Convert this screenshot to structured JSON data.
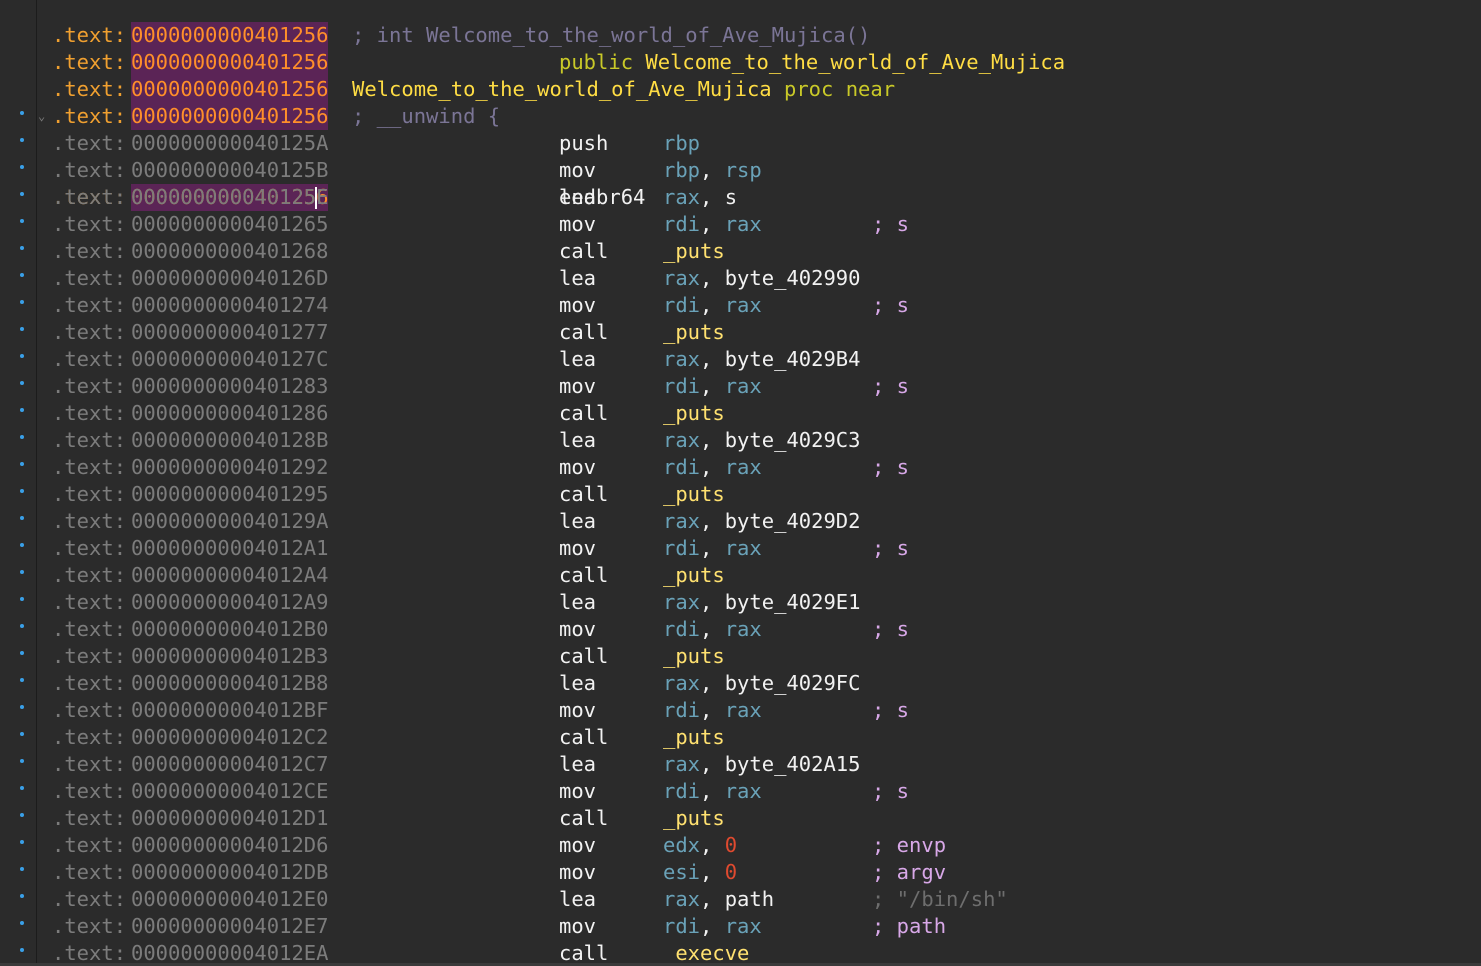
{
  "colors": {
    "background": "#2b2b2b",
    "highlight_address_bg": "#5b2456",
    "highlight_address_fg": "#ff8f2a",
    "register": "#6aa2b8",
    "symbol": "#ffe170",
    "number": "#e04a2f",
    "comment": "#d8a8e8",
    "breakpoint_dot": "#3aa0e8"
  },
  "header_lines": [
    {
      "prefix": ".text:",
      "address": "0000000000401256",
      "comment": "; int Welcome_to_the_world_of_Ave_Mujica()"
    },
    {
      "prefix": ".text:",
      "address": "0000000000401256",
      "keyword": "public",
      "name": "Welcome_to_the_world_of_Ave_Mujica"
    },
    {
      "prefix": ".text:",
      "address": "0000000000401256",
      "name": "Welcome_to_the_world_of_Ave_Mujica",
      "suffix": " proc near"
    },
    {
      "prefix": ".text:",
      "address": "0000000000401256",
      "comment": "; __unwind {"
    }
  ],
  "cursor_line": {
    "prefix": ".text:",
    "address_before_caret": "000000000040125",
    "address_after_caret": "6",
    "mnemonic": "endbr64",
    "fold_icon": "chevron-down-icon"
  },
  "instructions": [
    {
      "prefix": ".text:",
      "address": "000000000040125A",
      "mnemonic": "push",
      "ops": [
        {
          "t": "reg",
          "v": "rbp"
        }
      ],
      "comment": ""
    },
    {
      "prefix": ".text:",
      "address": "000000000040125B",
      "mnemonic": "mov",
      "ops": [
        {
          "t": "reg",
          "v": "rbp"
        },
        {
          "t": "sep",
          "v": ", "
        },
        {
          "t": "reg",
          "v": "rsp"
        }
      ],
      "comment": ""
    },
    {
      "prefix": ".text:",
      "address": "000000000040125E",
      "mnemonic": "lea",
      "ops": [
        {
          "t": "reg",
          "v": "rax"
        },
        {
          "t": "sep",
          "v": ", "
        },
        {
          "t": "plain",
          "v": "s"
        }
      ],
      "comment": ""
    },
    {
      "prefix": ".text:",
      "address": "0000000000401265",
      "mnemonic": "mov",
      "ops": [
        {
          "t": "reg",
          "v": "rdi"
        },
        {
          "t": "sep",
          "v": ", "
        },
        {
          "t": "reg",
          "v": "rax"
        }
      ],
      "comment": "; s"
    },
    {
      "prefix": ".text:",
      "address": "0000000000401268",
      "mnemonic": "call",
      "ops": [
        {
          "t": "sym",
          "v": "_puts"
        }
      ],
      "comment": ""
    },
    {
      "prefix": ".text:",
      "address": "000000000040126D",
      "mnemonic": "lea",
      "ops": [
        {
          "t": "reg",
          "v": "rax"
        },
        {
          "t": "sep",
          "v": ", "
        },
        {
          "t": "plain",
          "v": "byte_402990"
        }
      ],
      "comment": ""
    },
    {
      "prefix": ".text:",
      "address": "0000000000401274",
      "mnemonic": "mov",
      "ops": [
        {
          "t": "reg",
          "v": "rdi"
        },
        {
          "t": "sep",
          "v": ", "
        },
        {
          "t": "reg",
          "v": "rax"
        }
      ],
      "comment": "; s"
    },
    {
      "prefix": ".text:",
      "address": "0000000000401277",
      "mnemonic": "call",
      "ops": [
        {
          "t": "sym",
          "v": "_puts"
        }
      ],
      "comment": ""
    },
    {
      "prefix": ".text:",
      "address": "000000000040127C",
      "mnemonic": "lea",
      "ops": [
        {
          "t": "reg",
          "v": "rax"
        },
        {
          "t": "sep",
          "v": ", "
        },
        {
          "t": "plain",
          "v": "byte_4029B4"
        }
      ],
      "comment": ""
    },
    {
      "prefix": ".text:",
      "address": "0000000000401283",
      "mnemonic": "mov",
      "ops": [
        {
          "t": "reg",
          "v": "rdi"
        },
        {
          "t": "sep",
          "v": ", "
        },
        {
          "t": "reg",
          "v": "rax"
        }
      ],
      "comment": "; s"
    },
    {
      "prefix": ".text:",
      "address": "0000000000401286",
      "mnemonic": "call",
      "ops": [
        {
          "t": "sym",
          "v": "_puts"
        }
      ],
      "comment": ""
    },
    {
      "prefix": ".text:",
      "address": "000000000040128B",
      "mnemonic": "lea",
      "ops": [
        {
          "t": "reg",
          "v": "rax"
        },
        {
          "t": "sep",
          "v": ", "
        },
        {
          "t": "plain",
          "v": "byte_4029C3"
        }
      ],
      "comment": ""
    },
    {
      "prefix": ".text:",
      "address": "0000000000401292",
      "mnemonic": "mov",
      "ops": [
        {
          "t": "reg",
          "v": "rdi"
        },
        {
          "t": "sep",
          "v": ", "
        },
        {
          "t": "reg",
          "v": "rax"
        }
      ],
      "comment": "; s"
    },
    {
      "prefix": ".text:",
      "address": "0000000000401295",
      "mnemonic": "call",
      "ops": [
        {
          "t": "sym",
          "v": "_puts"
        }
      ],
      "comment": ""
    },
    {
      "prefix": ".text:",
      "address": "000000000040129A",
      "mnemonic": "lea",
      "ops": [
        {
          "t": "reg",
          "v": "rax"
        },
        {
          "t": "sep",
          "v": ", "
        },
        {
          "t": "plain",
          "v": "byte_4029D2"
        }
      ],
      "comment": ""
    },
    {
      "prefix": ".text:",
      "address": "00000000004012A1",
      "mnemonic": "mov",
      "ops": [
        {
          "t": "reg",
          "v": "rdi"
        },
        {
          "t": "sep",
          "v": ", "
        },
        {
          "t": "reg",
          "v": "rax"
        }
      ],
      "comment": "; s"
    },
    {
      "prefix": ".text:",
      "address": "00000000004012A4",
      "mnemonic": "call",
      "ops": [
        {
          "t": "sym",
          "v": "_puts"
        }
      ],
      "comment": ""
    },
    {
      "prefix": ".text:",
      "address": "00000000004012A9",
      "mnemonic": "lea",
      "ops": [
        {
          "t": "reg",
          "v": "rax"
        },
        {
          "t": "sep",
          "v": ", "
        },
        {
          "t": "plain",
          "v": "byte_4029E1"
        }
      ],
      "comment": ""
    },
    {
      "prefix": ".text:",
      "address": "00000000004012B0",
      "mnemonic": "mov",
      "ops": [
        {
          "t": "reg",
          "v": "rdi"
        },
        {
          "t": "sep",
          "v": ", "
        },
        {
          "t": "reg",
          "v": "rax"
        }
      ],
      "comment": "; s"
    },
    {
      "prefix": ".text:",
      "address": "00000000004012B3",
      "mnemonic": "call",
      "ops": [
        {
          "t": "sym",
          "v": "_puts"
        }
      ],
      "comment": ""
    },
    {
      "prefix": ".text:",
      "address": "00000000004012B8",
      "mnemonic": "lea",
      "ops": [
        {
          "t": "reg",
          "v": "rax"
        },
        {
          "t": "sep",
          "v": ", "
        },
        {
          "t": "plain",
          "v": "byte_4029FC"
        }
      ],
      "comment": ""
    },
    {
      "prefix": ".text:",
      "address": "00000000004012BF",
      "mnemonic": "mov",
      "ops": [
        {
          "t": "reg",
          "v": "rdi"
        },
        {
          "t": "sep",
          "v": ", "
        },
        {
          "t": "reg",
          "v": "rax"
        }
      ],
      "comment": "; s"
    },
    {
      "prefix": ".text:",
      "address": "00000000004012C2",
      "mnemonic": "call",
      "ops": [
        {
          "t": "sym",
          "v": "_puts"
        }
      ],
      "comment": ""
    },
    {
      "prefix": ".text:",
      "address": "00000000004012C7",
      "mnemonic": "lea",
      "ops": [
        {
          "t": "reg",
          "v": "rax"
        },
        {
          "t": "sep",
          "v": ", "
        },
        {
          "t": "plain",
          "v": "byte_402A15"
        }
      ],
      "comment": ""
    },
    {
      "prefix": ".text:",
      "address": "00000000004012CE",
      "mnemonic": "mov",
      "ops": [
        {
          "t": "reg",
          "v": "rdi"
        },
        {
          "t": "sep",
          "v": ", "
        },
        {
          "t": "reg",
          "v": "rax"
        }
      ],
      "comment": "; s"
    },
    {
      "prefix": ".text:",
      "address": "00000000004012D1",
      "mnemonic": "call",
      "ops": [
        {
          "t": "sym",
          "v": "_puts"
        }
      ],
      "comment": ""
    },
    {
      "prefix": ".text:",
      "address": "00000000004012D6",
      "mnemonic": "mov",
      "ops": [
        {
          "t": "reg",
          "v": "edx"
        },
        {
          "t": "sep",
          "v": ", "
        },
        {
          "t": "num",
          "v": "0"
        }
      ],
      "comment": "; envp"
    },
    {
      "prefix": ".text:",
      "address": "00000000004012DB",
      "mnemonic": "mov",
      "ops": [
        {
          "t": "reg",
          "v": "esi"
        },
        {
          "t": "sep",
          "v": ", "
        },
        {
          "t": "num",
          "v": "0"
        }
      ],
      "comment": "; argv"
    },
    {
      "prefix": ".text:",
      "address": "00000000004012E0",
      "mnemonic": "lea",
      "ops": [
        {
          "t": "reg",
          "v": "rax"
        },
        {
          "t": "sep",
          "v": ", "
        },
        {
          "t": "plain",
          "v": "path"
        }
      ],
      "comment": "; \"/bin/sh\"",
      "comment_dim": true
    },
    {
      "prefix": ".text:",
      "address": "00000000004012E7",
      "mnemonic": "mov",
      "ops": [
        {
          "t": "reg",
          "v": "rdi"
        },
        {
          "t": "sep",
          "v": ", "
        },
        {
          "t": "reg",
          "v": "rax"
        }
      ],
      "comment": "; path"
    },
    {
      "prefix": ".text:",
      "address": "00000000004012EA",
      "mnemonic": "call",
      "ops": [
        {
          "t": "sym",
          "v": "_execve"
        }
      ],
      "comment": ""
    }
  ]
}
